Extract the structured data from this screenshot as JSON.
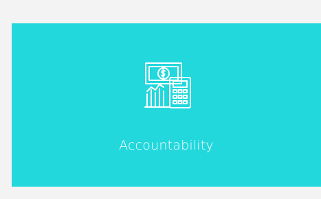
{
  "card": {
    "label": "Accountability",
    "icon": "money-calculator-icon",
    "background_color": "#22d8dc",
    "text_color": "#ffffff"
  },
  "page": {
    "background_color": "#f3f3f3"
  }
}
